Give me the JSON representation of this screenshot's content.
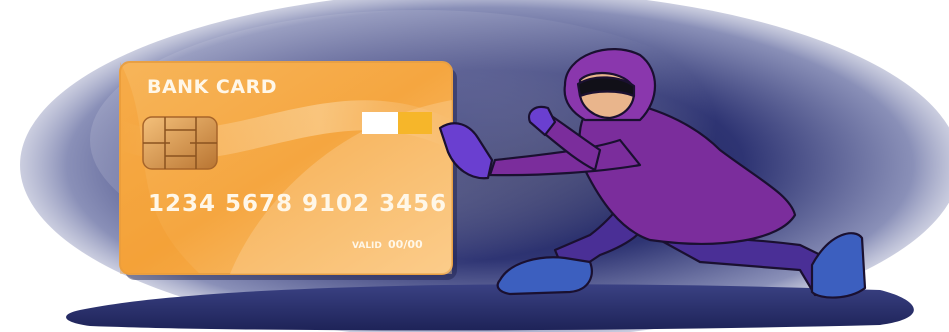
{
  "card": {
    "title": "BANK CARD",
    "number": "1234 5678 9102 3456",
    "valid_label": "VALID",
    "valid_value": "00/00"
  },
  "colors": {
    "background_smoke": "#2a2f6a",
    "card_orange": "#f3a63c",
    "card_light": "#fbd7a2",
    "chip_gold": "#c98a3e",
    "hoodie_purple": "#7b2d9c",
    "pants_purple": "#4a2f96",
    "shoe_blue": "#3c5fbf",
    "skin": "#e9b58c"
  },
  "icons": [
    "chip-icon",
    "thief-figure",
    "stripe-icon"
  ]
}
